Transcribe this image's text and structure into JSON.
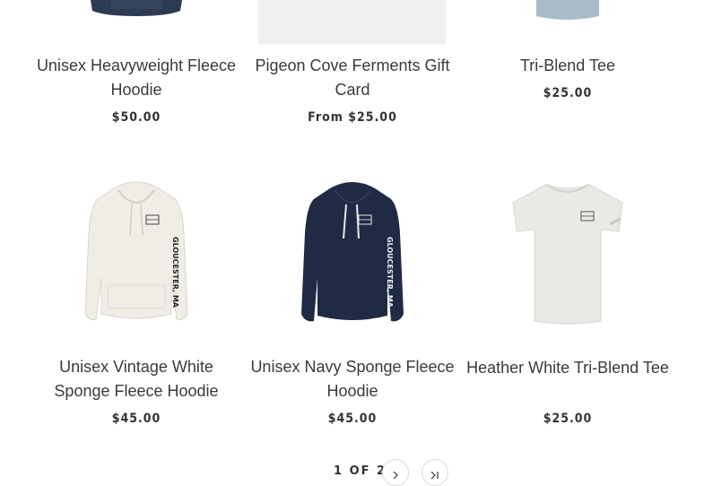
{
  "products": [
    {
      "title": "Unisex Heavyweight Fleece Hoodie",
      "price": "$50.00"
    },
    {
      "title": "Pigeon Cove Ferments Gift Card",
      "price": "From $25.00"
    },
    {
      "title": "Tri-Blend Tee",
      "price": "$25.00"
    },
    {
      "title": "Unisex Vintage White Sponge Fleece Hoodie",
      "price": "$45.00",
      "print": "GLOUCESTER, MA"
    },
    {
      "title": "Unisex Navy Sponge Fleece Hoodie",
      "price": "$45.00",
      "print": "GLOUCESTER, MA"
    },
    {
      "title": "Heather White Tri-Blend Tee",
      "price": "$25.00"
    }
  ],
  "pagination": {
    "count": "1 OF 2"
  },
  "colors": {
    "navy": "#1f2a44",
    "vintage_white": "#efede6",
    "heather_blue": "#9fb5c2",
    "heather_white": "#e9e9e6",
    "gift_card_gray": "#efefef"
  },
  "icons": {
    "next": "chevron-right-icon",
    "last": "last-page-icon"
  }
}
